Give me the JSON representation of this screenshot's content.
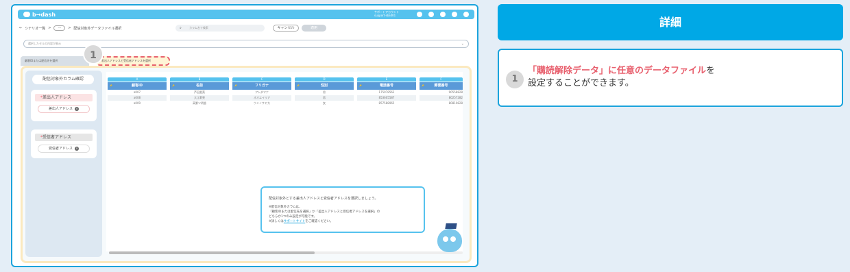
{
  "screenshot": {
    "app": {
      "logo_text": "b→dash",
      "account_name": "サポートアカウント",
      "account_id": "support-sbsd01"
    },
    "breadcrumb": {
      "back": "←",
      "parent": "シナリオ一覧",
      "sep1": ">",
      "dots": "···",
      "sep2": ">",
      "current": "配信対象外データファイル選択"
    },
    "search": {
      "placeholder": "カラム名で検索"
    },
    "buttons": {
      "cancel": "キャンセル",
      "apply": "適用"
    },
    "select_bar": {
      "placeholder": "選択したセルの内容が表示",
      "chevron": "⌄"
    },
    "step_badge": "1",
    "tabs": [
      {
        "label": "顧客IDまたは配信先を選択"
      },
      {
        "label": "差出人アドレスと受信者アドレスを選択"
      }
    ],
    "sidebar": {
      "title": "配信対象外カラム確認",
      "groups": [
        {
          "required": "*",
          "label": "差出人アドレス",
          "chip": "差出人アドレス"
        },
        {
          "required": "*",
          "label": "受信者アドレス",
          "chip": "受信者アドレス"
        }
      ]
    },
    "table": {
      "columns": [
        {
          "letter": "A",
          "key": "🔑",
          "header": "顧客ID",
          "cells": [
            "a007",
            "a008",
            "a009"
          ]
        },
        {
          "letter": "B",
          "key": "🔑",
          "header": "名前",
          "cells": [
            "芦田愛菜",
            "大江莉亮",
            "高野ツ明香"
          ]
        },
        {
          "letter": "C",
          "key": "🔑",
          "header": "フリガナ",
          "cells": [
            "アシダマナ",
            "オオエイリア",
            "ウミノサヤカ"
          ]
        },
        {
          "letter": "D",
          "key": "🔑",
          "header": "性別",
          "cells": [
            "男",
            "男",
            "女"
          ]
        },
        {
          "letter": "E",
          "key": "🔑",
          "header": "電話番号",
          "cells": [
            "175078562",
            "853605587",
            "857588965"
          ]
        },
        {
          "letter": "F",
          "key": "🔑",
          "header": "郵便番号",
          "cells": [
            "90558828",
            "80257282",
            "80810828"
          ]
        }
      ]
    },
    "tooltip": {
      "main": "配信対象外とする差出人アドレスと受信者アドレスを選択しましょう。",
      "note1": "※配信対象外カラムは、",
      "note2": "「顧客IDまたは配信先を選択」か「差出人アドレスと受信者アドレスを選択」の",
      "note3": "どちらか1つのみ設定が可能です。",
      "note4_pre": "※詳しくは",
      "note4_link": "サポートサイト",
      "note4_post": "をご確認ください。"
    }
  },
  "detail": {
    "header": "詳細",
    "badge": "1",
    "highlight": "「購読解除データ」に任意のデータファイル",
    "text_after": "を",
    "line2": "設定することができます。"
  },
  "colors": {
    "accent": "#00a8e6",
    "highlight": "#e8606e",
    "table_header": "#5a9ad8"
  }
}
